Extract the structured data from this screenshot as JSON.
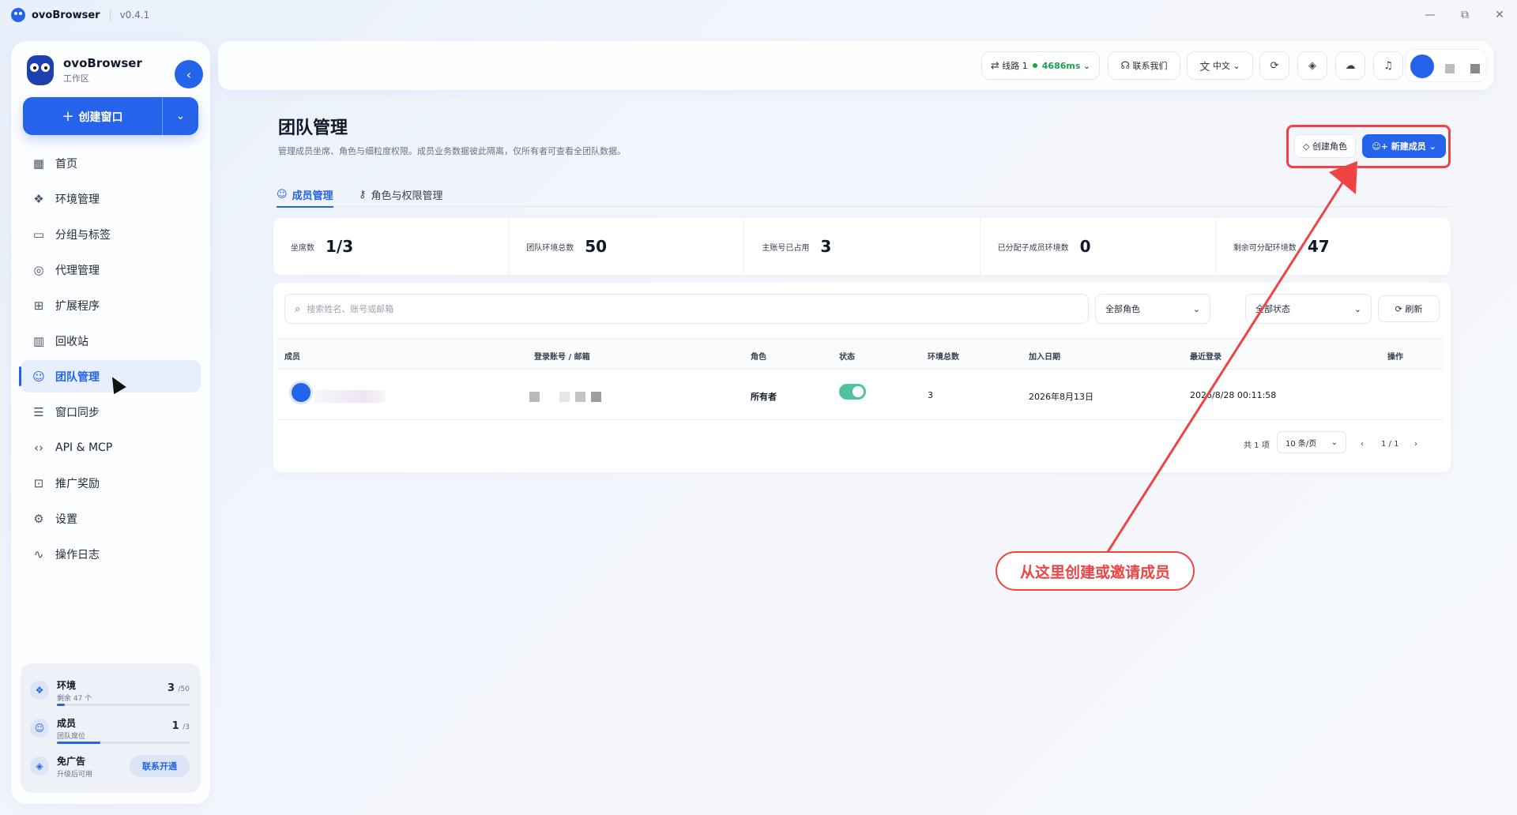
{
  "titlebar": {
    "app": "ovoBrowser",
    "version": "v0.4.1",
    "min": "—",
    "max": "⧉",
    "close": "✕"
  },
  "sidebar": {
    "brand": "ovoBrowser",
    "workspace": "工作区",
    "create_label": "创建窗口",
    "items": [
      {
        "label": "首页",
        "icon": "grid-icon"
      },
      {
        "label": "环境管理",
        "icon": "cubes-icon"
      },
      {
        "label": "分组与标签",
        "icon": "folder-icon"
      },
      {
        "label": "代理管理",
        "icon": "globe-icon"
      },
      {
        "label": "扩展程序",
        "icon": "puzzle-icon"
      },
      {
        "label": "回收站",
        "icon": "trash-icon"
      },
      {
        "label": "团队管理",
        "icon": "users-icon",
        "active": true
      },
      {
        "label": "窗口同步",
        "icon": "sliders-icon"
      },
      {
        "label": "API & MCP",
        "icon": "code-icon"
      },
      {
        "label": "推广奖励",
        "icon": "gift-icon"
      },
      {
        "label": "设置",
        "icon": "gear-icon"
      },
      {
        "label": "操作日志",
        "icon": "activity-icon"
      }
    ],
    "quota": {
      "env": {
        "title": "环境",
        "sub": "剩余 47 个",
        "used": "3",
        "total": "/50",
        "progress": 0.06
      },
      "member": {
        "title": "成员",
        "sub": "团队席位",
        "used": "1",
        "total": "/3",
        "progress": 0.33
      },
      "ads": {
        "title": "免广告",
        "sub": "升级后可用",
        "action": "联系开通"
      }
    }
  },
  "topbar": {
    "line": "线路 1",
    "latency": "4686ms",
    "contact": "联系我们",
    "lang": "中文"
  },
  "page": {
    "title": "团队管理",
    "desc": "管理成员坐席、角色与细粒度权限。成员业务数据彼此隔离，仅所有者可查看全团队数据。",
    "btn_role": "创建角色",
    "btn_member": "新建成员",
    "tabs": [
      {
        "label": "成员管理"
      },
      {
        "label": "角色与权限管理"
      }
    ],
    "stats": [
      {
        "label": "坐席数",
        "value": "1/3"
      },
      {
        "label": "团队环境总数",
        "value": "50"
      },
      {
        "label": "主账号已占用",
        "value": "3"
      },
      {
        "label": "已分配子成员环境数",
        "value": "0"
      },
      {
        "label": "剩余可分配环境数",
        "value": "47"
      }
    ],
    "search_placeholder": "搜索姓名、账号或邮箱",
    "filter_role": "全部角色",
    "filter_status": "全部状态",
    "refresh": "刷新",
    "columns": [
      "成员",
      "登录账号 / 邮箱",
      "角色",
      "状态",
      "环境总数",
      "加入日期",
      "最近登录",
      "操作"
    ],
    "row": {
      "role": "所有者",
      "status_on": true,
      "env_total": "3",
      "join_date": "2026年8月13日",
      "last_login": "2026/8/28 00:11:58"
    },
    "pager": {
      "total": "共 1 项",
      "page_size": "10 条/页",
      "page": "1 / 1"
    }
  },
  "annotation": {
    "callout": "从这里创建或邀请成员"
  }
}
